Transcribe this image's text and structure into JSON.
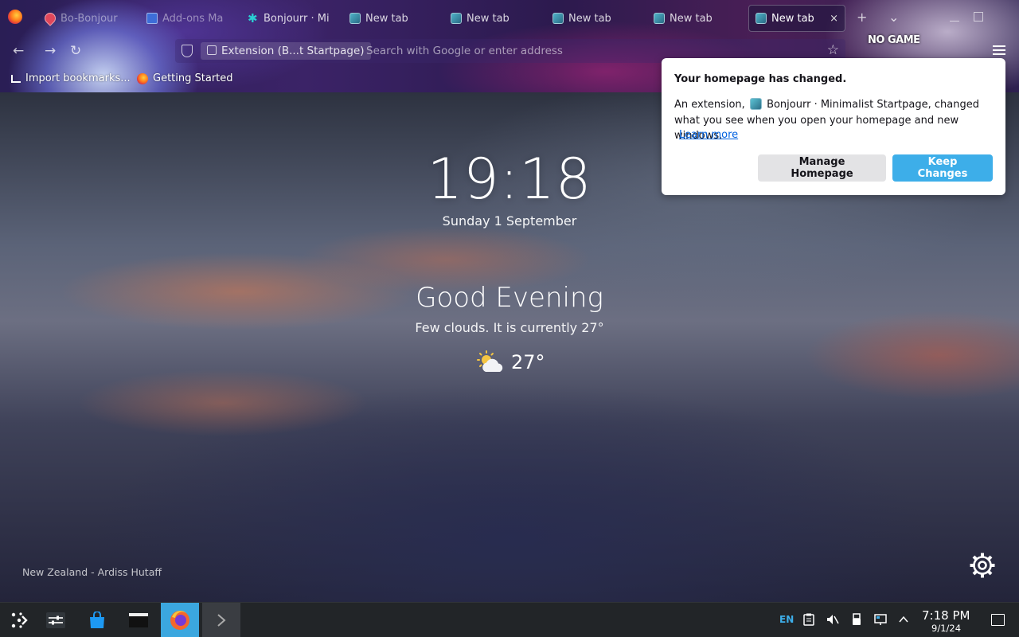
{
  "browser": {
    "tabs": [
      {
        "label": "Bo-Bonjour",
        "faded": true
      },
      {
        "label": "Add-ons Ma",
        "faded": true
      },
      {
        "label": "Bonjourr · Mi",
        "faded": false
      },
      {
        "label": "New tab",
        "faded": false
      },
      {
        "label": "New tab",
        "faded": false
      },
      {
        "label": "New tab",
        "faded": false
      },
      {
        "label": "New tab",
        "faded": false
      },
      {
        "label": "New tab",
        "active": true
      }
    ],
    "new_tab_label": "+",
    "list_all_tabs_label": "⌄",
    "close_tab_label": "×",
    "theme_logo_text": "NO GAME",
    "url_identity_label": "Extension (B...t Startpage)",
    "url_placeholder": "Search with Google or enter address",
    "bookmarks": [
      {
        "label": "Import bookmarks...",
        "icon": "import-icon"
      },
      {
        "label": "Getting Started",
        "icon": "firefox-icon"
      }
    ]
  },
  "startpage": {
    "time": "19:18",
    "date": "Sunday 1 September",
    "greeting": "Good Evening",
    "weather_description": "Few clouds. It is currently 27°",
    "temperature": "27°",
    "weather_icon": "partly-cloudy-icon",
    "photo_credit": "New Zealand - Ardiss Hutaff"
  },
  "popup": {
    "title": "Your homepage has changed.",
    "body_prefix": "An extension,",
    "extension_name": "Bonjourr · Minimalist Startpage",
    "body_suffix": ", changed what you see when you open your homepage and new windows.",
    "learn_more": "Learn more",
    "manage_button": "Manage Homepage",
    "keep_button": "Keep Changes"
  },
  "taskbar": {
    "language": "EN",
    "time": "7:18 PM",
    "date": "9/1/24",
    "colors": {
      "accent": "#3daee9",
      "background": "#222528"
    }
  }
}
